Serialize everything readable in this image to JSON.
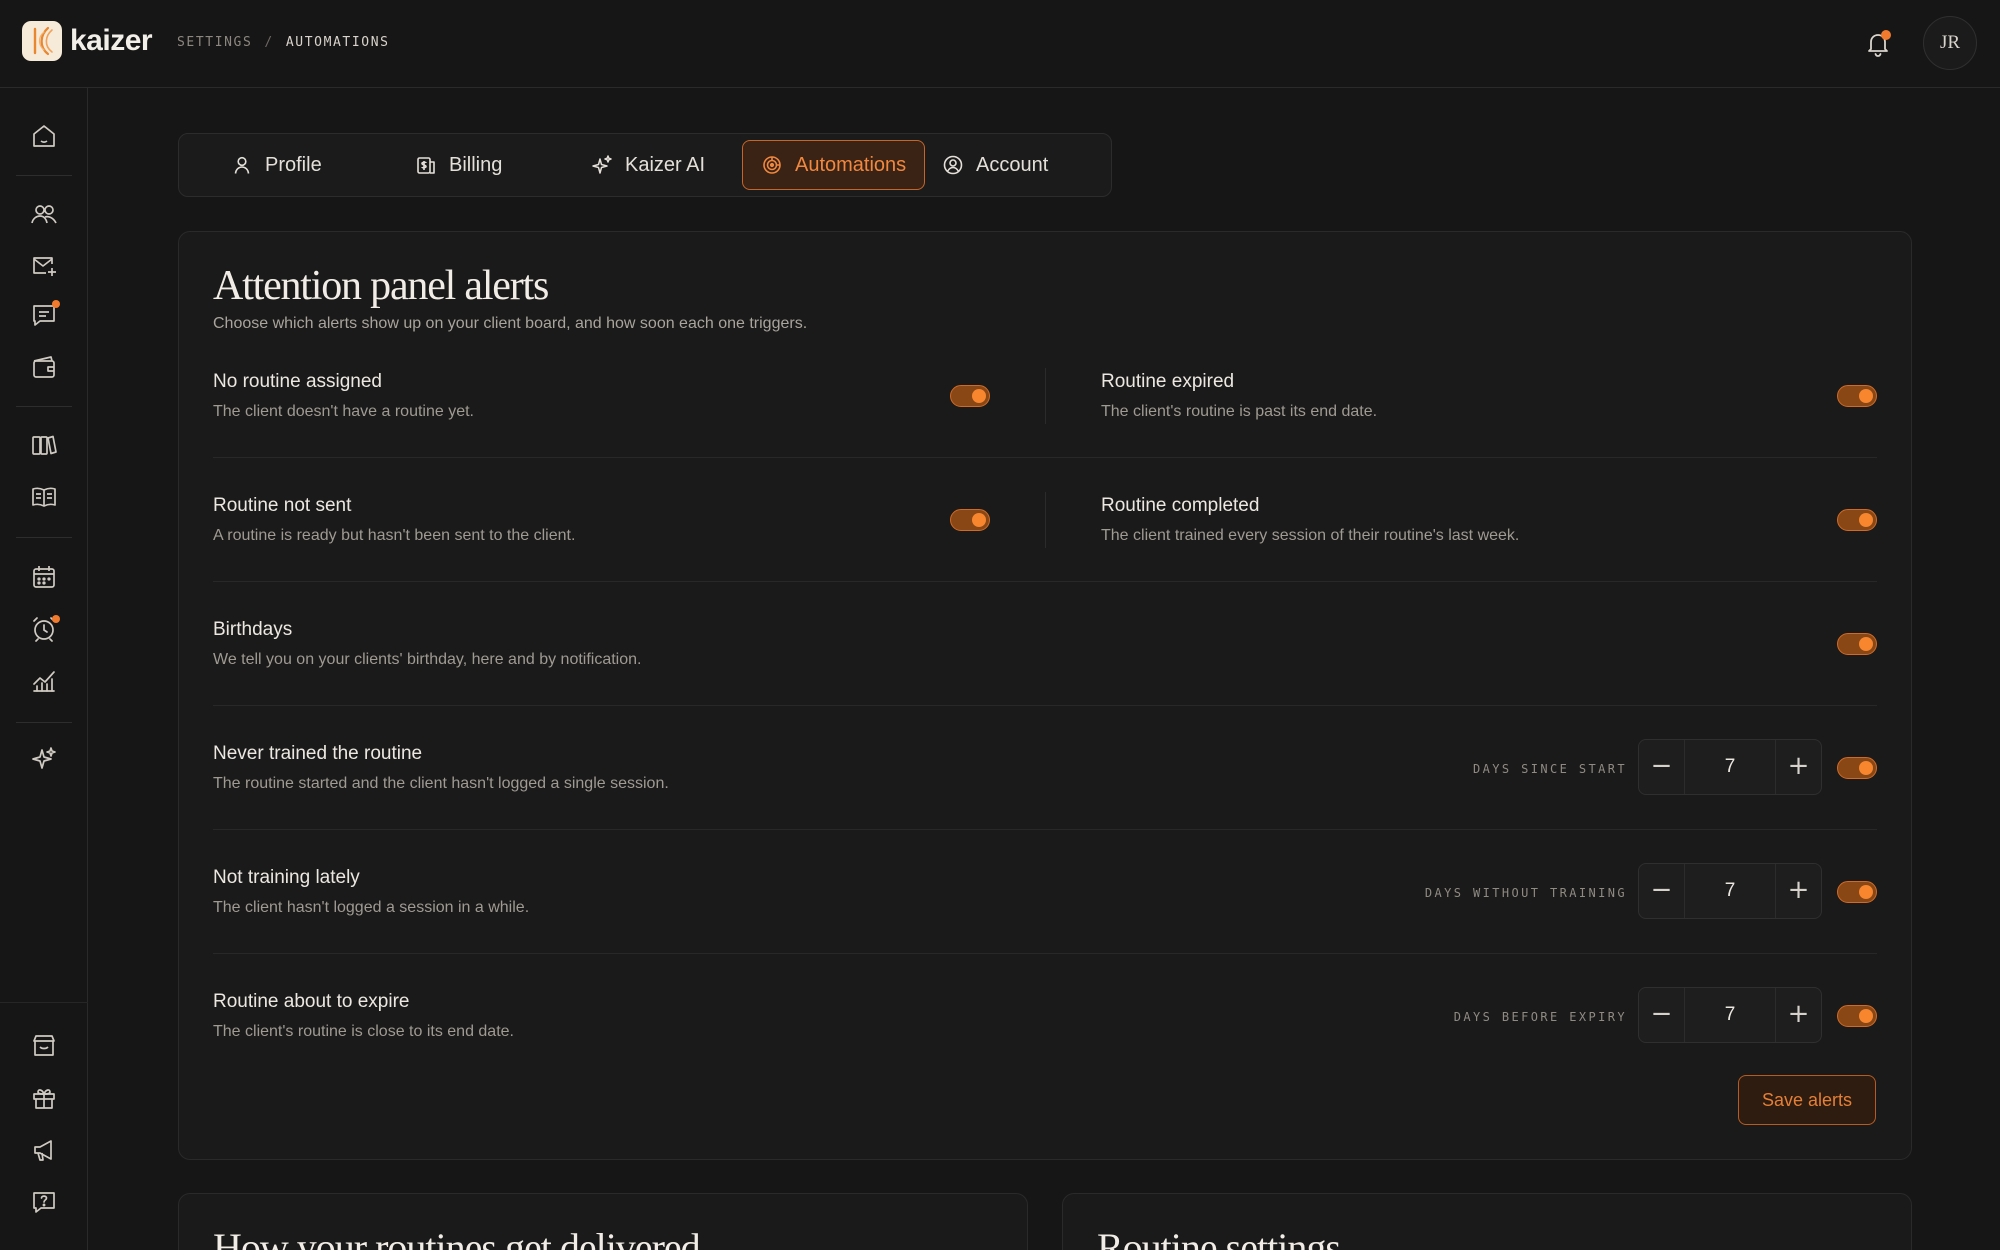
{
  "app": {
    "brand": "kaizer"
  },
  "breadcrumb": {
    "parent": "SETTINGS",
    "separator": "/",
    "current": "AUTOMATIONS"
  },
  "user": {
    "initials": "JR"
  },
  "colors": {
    "accent": "#f07a2d",
    "background": "#161616",
    "card": "#1a1a1a"
  },
  "sidebar": {
    "icons": [
      "home-icon",
      "clients-icon",
      "invite-mail-icon",
      "messages-icon",
      "wallet-icon",
      "exercise-library-icon",
      "routine-book-icon",
      "calendar-icon",
      "alarm-icon",
      "analytics-icon",
      "ai-sparkle-icon",
      "store-icon",
      "gift-icon",
      "megaphone-icon",
      "help-icon"
    ]
  },
  "tabs": [
    {
      "label": "Profile",
      "icon": "user-icon",
      "active": false
    },
    {
      "label": "Billing",
      "icon": "billing-icon",
      "active": false
    },
    {
      "label": "Kaizer AI",
      "icon": "sparkle-icon",
      "active": false
    },
    {
      "label": "Automations",
      "icon": "automations-icon",
      "active": true
    },
    {
      "label": "Account",
      "icon": "account-icon",
      "active": false
    }
  ],
  "alerts_panel": {
    "title": "Attention panel alerts",
    "subtitle": "Choose which alerts show up on your client board, and how soon each one triggers.",
    "pairs": [
      {
        "left": {
          "title": "No routine assigned",
          "desc": "The client doesn't have a routine yet.",
          "enabled": true
        },
        "right": {
          "title": "Routine expired",
          "desc": "The client's routine is past its end date.",
          "enabled": true
        }
      },
      {
        "left": {
          "title": "Routine not sent",
          "desc": "A routine is ready but hasn't been sent to the client.",
          "enabled": true
        },
        "right": {
          "title": "Routine completed",
          "desc": "The client trained every session of their routine's last week.",
          "enabled": true
        }
      }
    ],
    "birthdays": {
      "title": "Birthdays",
      "desc": "We tell you on your clients' birthday, here and by notification.",
      "enabled": true
    },
    "threshold_rows": [
      {
        "title": "Never trained the routine",
        "desc": "The routine started and the client hasn't logged a single session.",
        "label": "DAYS SINCE START",
        "value": "7",
        "enabled": true
      },
      {
        "title": "Not training lately",
        "desc": "The client hasn't logged a session in a while.",
        "label": "DAYS WITHOUT TRAINING",
        "value": "7",
        "enabled": true
      },
      {
        "title": "Routine about to expire",
        "desc": "The client's routine is close to its end date.",
        "label": "DAYS BEFORE EXPIRY",
        "value": "7",
        "enabled": true
      }
    ],
    "stepper": {
      "minus": "−",
      "plus": "+"
    },
    "save_label": "Save alerts"
  },
  "delivery_card": {
    "title": "How your routines get delivered"
  },
  "routine_settings_card": {
    "title": "Routine settings"
  }
}
